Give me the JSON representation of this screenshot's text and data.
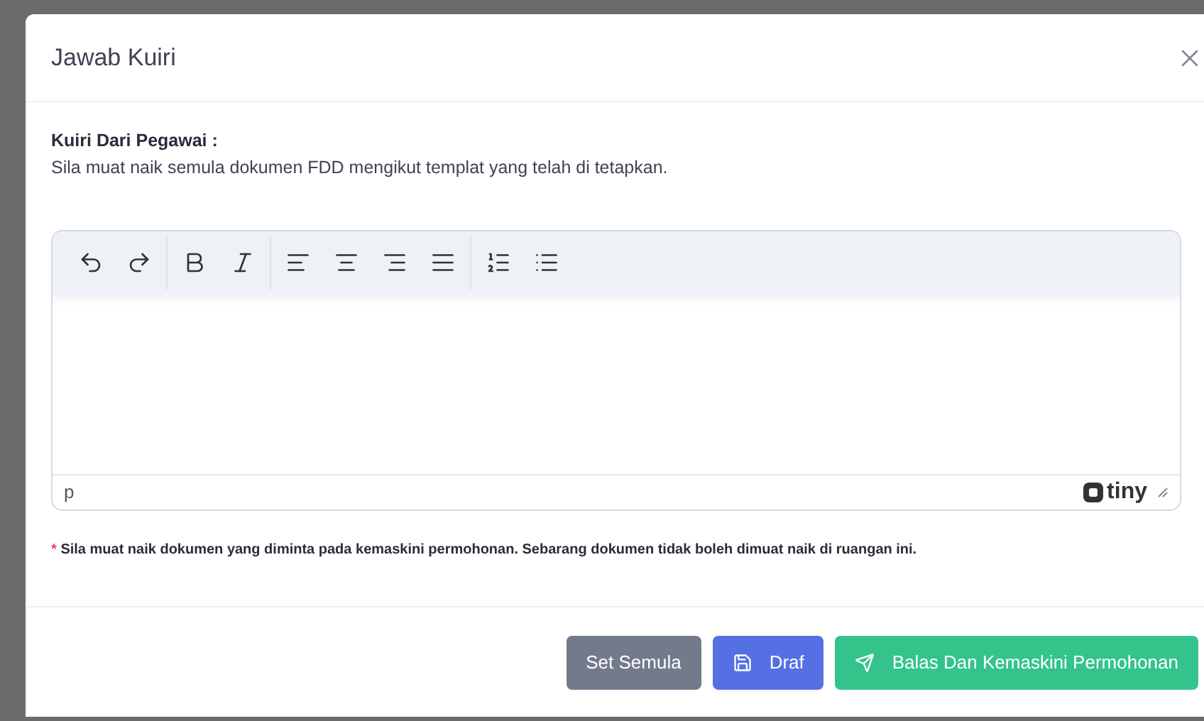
{
  "dialog": {
    "title": "Jawab Kuiri",
    "query_label": "Kuiri Dari Pegawai :",
    "query_text": "Sila muat naik semula dokumen FDD mengikut templat yang telah di tetapkan.",
    "editor": {
      "status_path": "p",
      "brand": "tiny"
    },
    "note_mark": "*",
    "note": "Sila muat naik dokumen yang diminta pada kemaskini permohonan. Sebarang dokumen tidak boleh dimuat naik di ruangan ini.",
    "buttons": [
      {
        "kind": "reset",
        "label": "Set Semula"
      },
      {
        "kind": "draft",
        "label": "Draf"
      },
      {
        "kind": "submit",
        "label": "Balas Dan Kemaskini Permohonan"
      }
    ]
  }
}
